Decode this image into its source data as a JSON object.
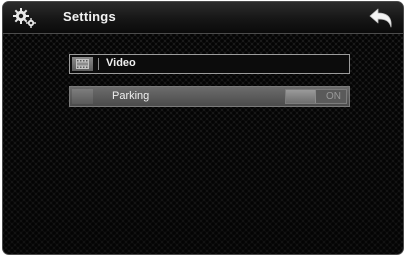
{
  "header": {
    "title": "Settings",
    "icon": "gears-icon",
    "back_icon": "back-arrow-icon"
  },
  "items": [
    {
      "label": "Video",
      "icon": "film-icon"
    },
    {
      "label": "Parking",
      "toggle_state": "ON"
    }
  ],
  "colors": {
    "background": "#131313",
    "text": "#f2f2f2",
    "row_highlight": "#5f5f5f"
  }
}
